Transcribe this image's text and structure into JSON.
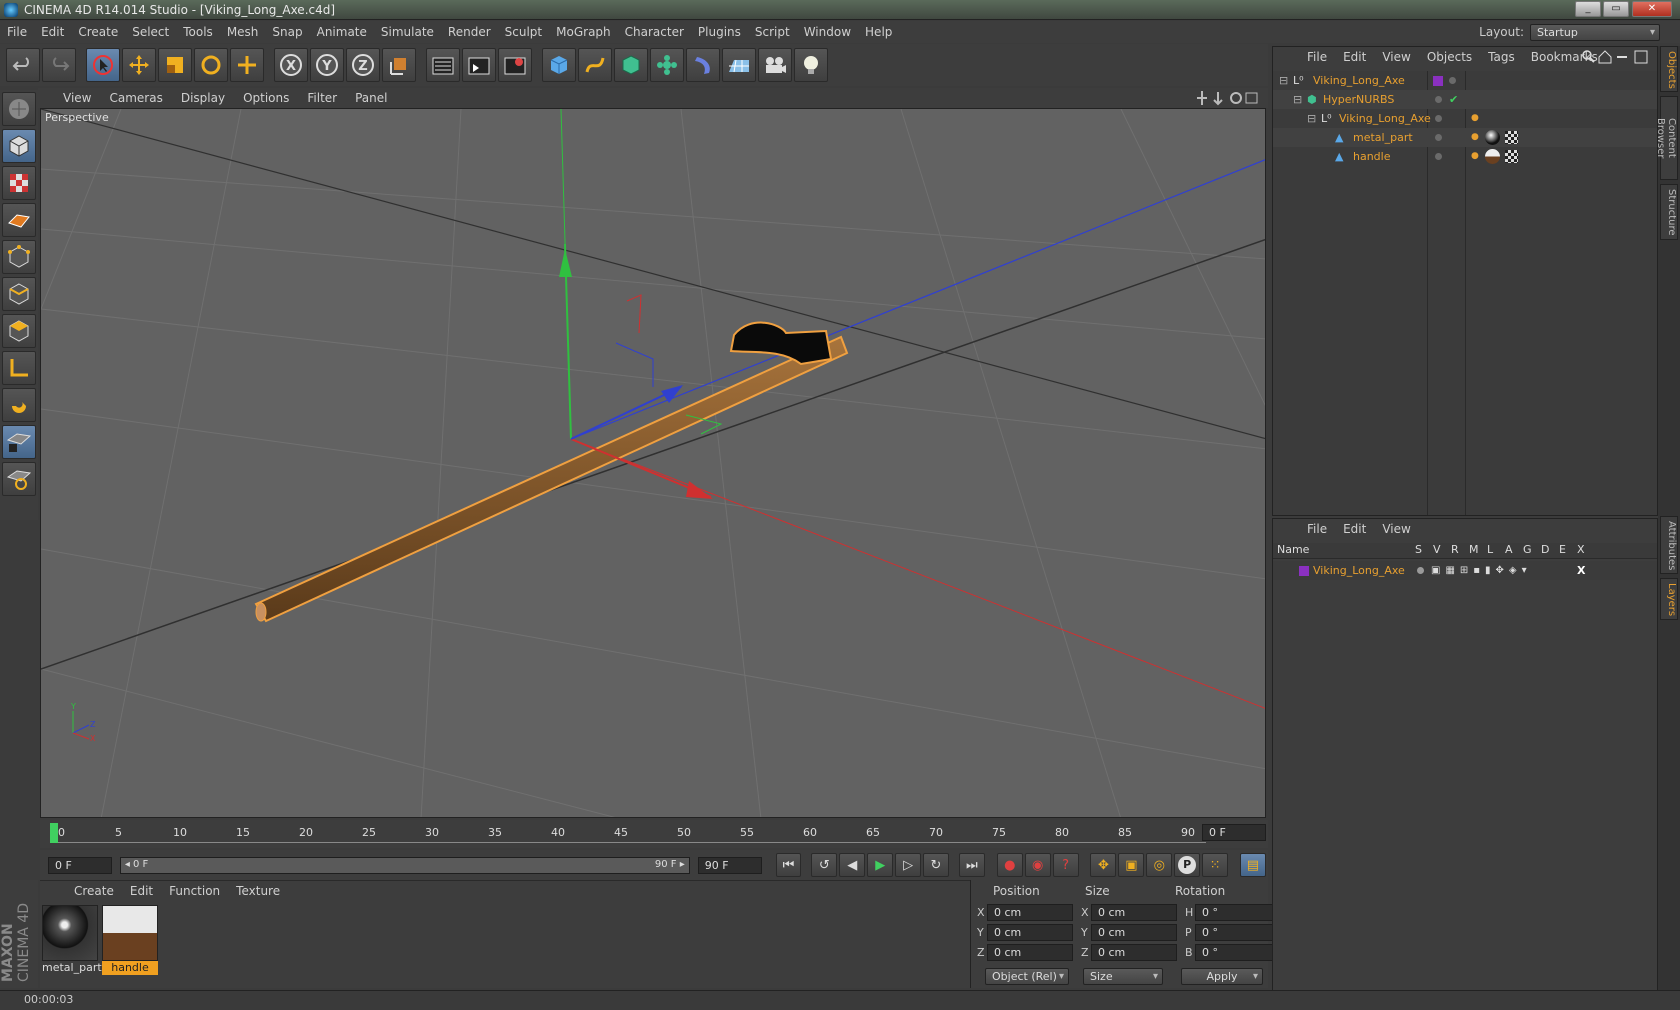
{
  "window": {
    "title": "CINEMA 4D R14.014 Studio - [Viking_Long_Axe.c4d]",
    "min": "_",
    "max": "▭",
    "close": "✕"
  },
  "menu": [
    "File",
    "Edit",
    "Create",
    "Select",
    "Tools",
    "Mesh",
    "Snap",
    "Animate",
    "Simulate",
    "Render",
    "Sculpt",
    "MoGraph",
    "Character",
    "Plugins",
    "Script",
    "Window",
    "Help"
  ],
  "layout": {
    "label": "Layout:",
    "value": "Startup"
  },
  "toolbar": {
    "groups": [
      [
        "undo-icon",
        "redo-icon"
      ],
      [
        "live-selection-icon",
        "move-icon",
        "scale-icon",
        "rotate-icon",
        "add-icon"
      ],
      [
        "x-axis-icon",
        "y-axis-icon",
        "z-axis-icon",
        "coordinate-system-icon"
      ],
      [
        "render-view-icon",
        "render-picture-viewer-icon",
        "render-settings-icon"
      ],
      [
        "cube-icon",
        "spline-pen-icon",
        "subdivision-icon",
        "mograph-cloner-icon",
        "deformer-icon",
        "floor-icon",
        "camera-icon",
        "light-icon"
      ]
    ],
    "axis_labels": {
      "x": "X",
      "y": "Y",
      "z": "Z"
    }
  },
  "left_tools": [
    "make-editable-icon",
    "model-mode-icon",
    "texture-mode-icon",
    "workplane-icon",
    "points-mode-icon",
    "edges-mode-icon",
    "polygons-mode-icon",
    "axis-mode-icon",
    "snap-magnet-icon",
    "locked-workplane-icon",
    "planar-workplane-icon"
  ],
  "viewport": {
    "menu": [
      "View",
      "Cameras",
      "Display",
      "Options",
      "Filter",
      "Panel"
    ],
    "label": "Perspective",
    "axes": {
      "x": "X",
      "y": "Y",
      "z": "Z"
    }
  },
  "timeline": {
    "ticks": [
      "0",
      "5",
      "10",
      "15",
      "20",
      "25",
      "30",
      "35",
      "40",
      "45",
      "50",
      "55",
      "60",
      "65",
      "70",
      "75",
      "80",
      "85",
      "90"
    ],
    "current_frame": "0 F"
  },
  "transport": {
    "start": "0 F",
    "range_start": "◂ 0 F",
    "range_end": "90 F ▸",
    "end": "90 F",
    "buttons": [
      "go-to-start-icon",
      "prev-key-icon",
      "prev-frame-icon",
      "play-icon",
      "next-frame-icon",
      "next-key-icon",
      "go-to-end-icon",
      "record-icon",
      "autokey-icon",
      "help-keyframe-icon",
      "keyframe-position-icon",
      "keyframe-scale-icon",
      "keyframe-rotation-icon",
      "keyframe-parameter-icon",
      "keyframe-pla-icon",
      "timeline-icon"
    ],
    "param_label": "P"
  },
  "materials": {
    "menu": [
      "Create",
      "Edit",
      "Function",
      "Texture"
    ],
    "items": [
      {
        "name": "metal_part",
        "selected": false
      },
      {
        "name": "handle",
        "selected": true
      }
    ]
  },
  "coordinates": {
    "headers": {
      "position": "Position",
      "size": "Size",
      "rotation": "Rotation"
    },
    "rows": [
      {
        "pl": "X",
        "pv": "0 cm",
        "sl": "X",
        "sv": "0 cm",
        "rl": "H",
        "rv": "0 °"
      },
      {
        "pl": "Y",
        "pv": "0 cm",
        "sl": "Y",
        "sv": "0 cm",
        "rl": "P",
        "rv": "0 °"
      },
      {
        "pl": "Z",
        "pv": "0 cm",
        "sl": "Z",
        "sv": "0 cm",
        "rl": "B",
        "rv": "0 °"
      }
    ],
    "mode": "Object (Rel)",
    "size_mode": "Size",
    "apply": "Apply"
  },
  "objects": {
    "menu": [
      "File",
      "Edit",
      "View",
      "Objects",
      "Tags",
      "Bookmarks"
    ],
    "rows": [
      {
        "name": "Viking_Long_Axe",
        "indent": 0
      },
      {
        "name": "HyperNURBS",
        "indent": 1
      },
      {
        "name": "Viking_Long_Axe",
        "indent": 2
      },
      {
        "name": "metal_part",
        "indent": 3
      },
      {
        "name": "handle",
        "indent": 3
      }
    ]
  },
  "layers": {
    "menu": [
      "File",
      "Edit",
      "View"
    ],
    "columns": [
      "Name",
      "S",
      "V",
      "R",
      "M",
      "L",
      "A",
      "G",
      "D",
      "E",
      "X"
    ],
    "rows": [
      {
        "name": "Viking_Long_Axe"
      }
    ]
  },
  "side_tabs": [
    "Objects",
    "Content Browser",
    "Structure",
    "Attributes",
    "Layers"
  ],
  "brand": {
    "line1": "MAXON",
    "line2": "CINEMA 4D"
  },
  "status": {
    "time": "00:00:03"
  },
  "colors": {
    "accent": "#e8a030",
    "viewport": "#626262",
    "panel": "#3d3d3d"
  }
}
